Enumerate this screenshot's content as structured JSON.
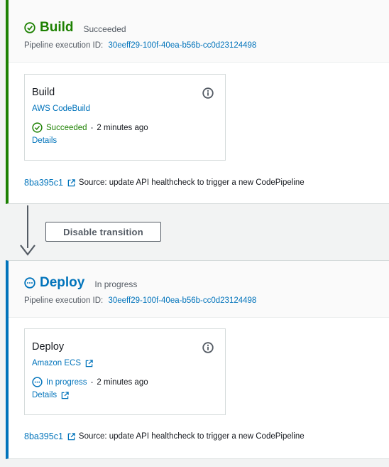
{
  "stages": {
    "build": {
      "name": "Build",
      "status": "Succeeded",
      "execution_label": "Pipeline execution ID:",
      "execution_id": "30eeff29-100f-40ea-b56b-cc0d23124498",
      "action": {
        "name": "Build",
        "provider": "AWS CodeBuild",
        "status": "Succeeded",
        "separator": "-",
        "time_ago": "2 minutes ago",
        "details_label": "Details"
      },
      "commit": {
        "id": "8ba395c1",
        "message": "Source: update API healthcheck to trigger a new CodePipeline"
      }
    },
    "deploy": {
      "name": "Deploy",
      "status": "In progress",
      "execution_label": "Pipeline execution ID:",
      "execution_id": "30eeff29-100f-40ea-b56b-cc0d23124498",
      "action": {
        "name": "Deploy",
        "provider": "Amazon ECS",
        "status": "In progress",
        "separator": "-",
        "time_ago": "2 minutes ago",
        "details_label": "Details"
      },
      "commit": {
        "id": "8ba395c1",
        "message": "Source: update API healthcheck to trigger a new CodePipeline"
      }
    }
  },
  "transition": {
    "button_label": "Disable transition"
  },
  "colors": {
    "success": "#1d8102",
    "in_progress": "#0073bb",
    "link": "#0073bb",
    "muted": "#545b64"
  },
  "icons": {
    "success": "check-circle-icon",
    "in_progress": "ellipsis-circle-icon",
    "info": "info-icon",
    "external": "external-link-icon",
    "arrow": "arrow-down-icon"
  }
}
